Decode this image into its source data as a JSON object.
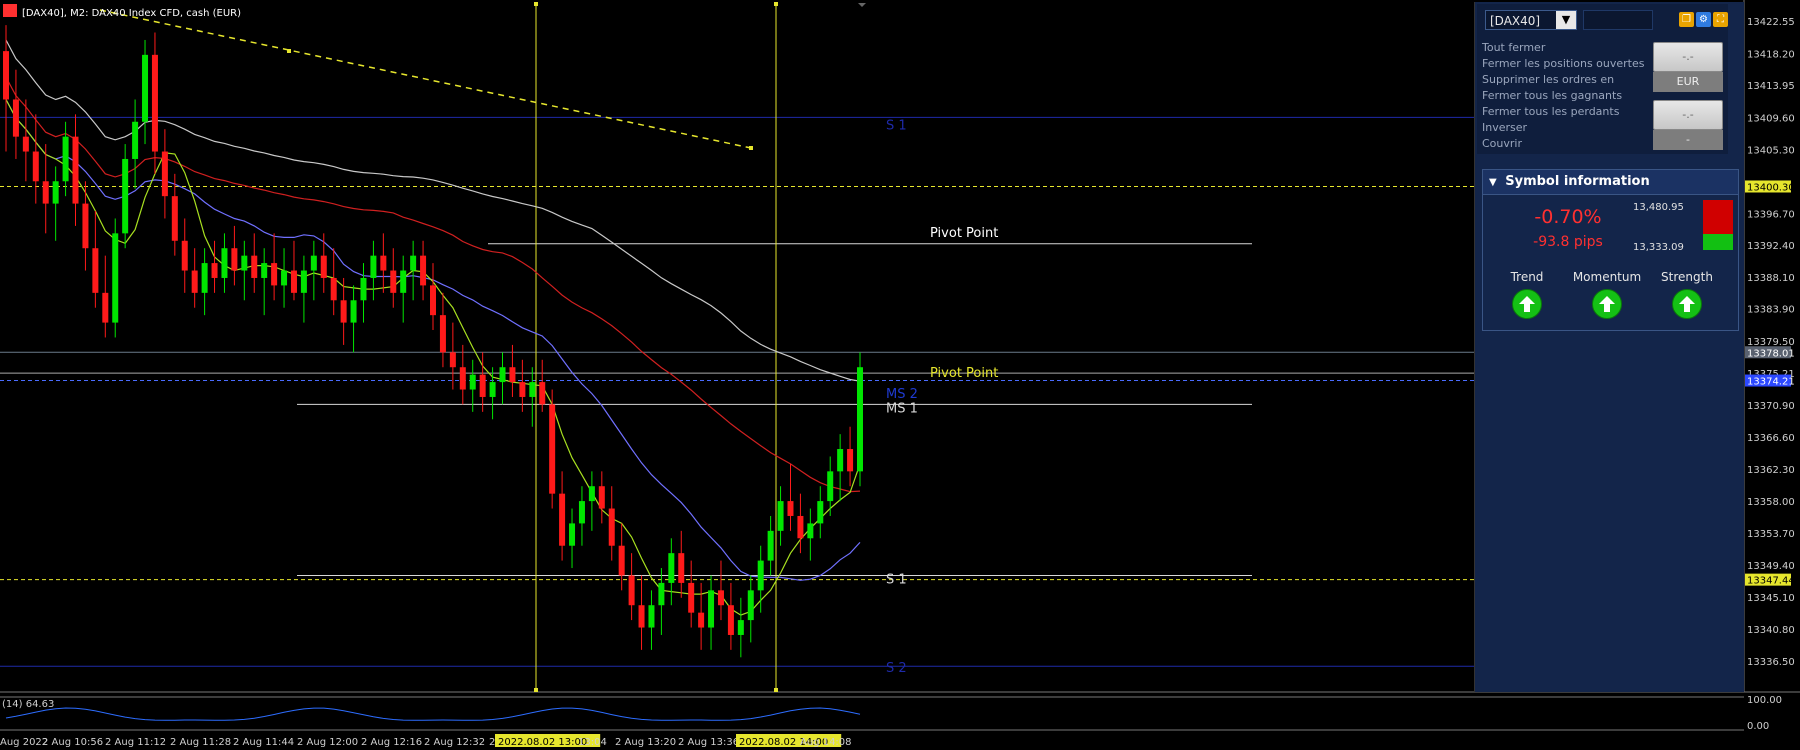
{
  "window_title": "[DAX40], M2:  DAX40 Index CFD, cash (EUR)",
  "colors": {
    "bull": "#00e600",
    "bear": "#ff1a1a",
    "panel": "#13254a",
    "accent_red": "#ff3030",
    "trend_green": "#14c014"
  },
  "price_scale": {
    "ticks": [
      "13422.55",
      "13418.20",
      "13413.95",
      "13409.60",
      "13405.30",
      "13400.30",
      "13396.70",
      "13392.40",
      "13388.10",
      "13383.90",
      "13379.50",
      "13378.01",
      "13375.21",
      "13374.21",
      "13370.90",
      "13366.60",
      "13362.30",
      "13358.00",
      "13353.70",
      "13349.40",
      "13347.44",
      "13345.10",
      "13340.80",
      "13336.50"
    ],
    "markers": [
      {
        "label": "13400.30",
        "style": "yellow"
      },
      {
        "label": "13378.01",
        "style": "gray"
      },
      {
        "label": "13374.21",
        "style": "blue"
      },
      {
        "label": "13347.44",
        "style": "yellow"
      }
    ]
  },
  "levels": [
    {
      "label": "S 1",
      "price": 13409.6
    },
    {
      "label": "Pivot Point",
      "price": 13392.6
    },
    {
      "label": "Pivot Point",
      "price": 13374.8
    },
    {
      "label": "MS 2",
      "price": 13373.6
    },
    {
      "label": "MS 1",
      "price": 13371.0
    },
    {
      "label": "S 1",
      "price": 13348.0
    },
    {
      "label": "S 2",
      "price": 13335.8
    }
  ],
  "time_axis": [
    "Aug 2022",
    "2 Aug 10:56",
    "2 Aug 11:12",
    "2 Aug 11:28",
    "2 Aug 11:44",
    "2 Aug 12:00",
    "2 Aug 12:16",
    "2 Aug 12:32",
    "2 Aug 12:",
    "2022.08.02 13:00",
    "13:04",
    "2 Aug 13:20",
    "2 Aug 13:36",
    "2022.08.02 14:00",
    "Aug 14:08"
  ],
  "oscillator": {
    "label": "(14) 64.63",
    "levels": [
      "100.00",
      "0.00"
    ]
  },
  "trade_panel": {
    "symbol": "[DAX40]",
    "actions": [
      "Tout fermer",
      "Fermer les positions ouvertes",
      "Supprimer les ordres en",
      "Fermer tous les gagnants",
      "Fermer tous les perdants",
      "Inverser",
      "Couvrir"
    ],
    "button1": "-.-",
    "button1_sub": "EUR",
    "button2": "-.-",
    "button2_sub": "-"
  },
  "symbol_info": {
    "title": "Symbol information",
    "change_pct": "-0.70%",
    "change_pips": "-93.8 pips",
    "high": "13,480.95",
    "low": "13,333.09",
    "indicators": [
      {
        "label": "Trend",
        "direction": "up"
      },
      {
        "label": "Momentum",
        "direction": "up"
      },
      {
        "label": "Strength",
        "direction": "up"
      }
    ]
  },
  "chart_data": {
    "type": "candlestick",
    "candles": [
      [
        13418.5,
        13422,
        13405,
        13412
      ],
      [
        13412,
        13416,
        13404,
        13407
      ],
      [
        13407,
        13412,
        13401,
        13405
      ],
      [
        13405,
        13410,
        13398,
        13401
      ],
      [
        13401,
        13406,
        13394,
        13398
      ],
      [
        13398,
        13403,
        13393,
        13401
      ],
      [
        13401,
        13409,
        13399,
        13407
      ],
      [
        13407,
        13410,
        13395,
        13398
      ],
      [
        13398,
        13401,
        13389,
        13392
      ],
      [
        13392,
        13397,
        13384,
        13386
      ],
      [
        13386,
        13391,
        13380,
        13382
      ],
      [
        13382,
        13396,
        13380,
        13394
      ],
      [
        13394,
        13406,
        13392,
        13404
      ],
      [
        13404,
        13412,
        13400,
        13409
      ],
      [
        13409,
        13420,
        13406,
        13418
      ],
      [
        13418,
        13421,
        13402,
        13405
      ],
      [
        13405,
        13408,
        13396,
        13399
      ],
      [
        13399,
        13402,
        13391,
        13393
      ],
      [
        13393,
        13396,
        13386,
        13389
      ],
      [
        13389,
        13392,
        13384,
        13386
      ],
      [
        13386,
        13392,
        13383,
        13390
      ],
      [
        13390,
        13393,
        13386,
        13388
      ],
      [
        13388,
        13394,
        13386,
        13392
      ],
      [
        13392,
        13395,
        13387,
        13389
      ],
      [
        13389,
        13393,
        13385,
        13391
      ],
      [
        13391,
        13394,
        13386,
        13388
      ],
      [
        13388,
        13392,
        13383,
        13390
      ],
      [
        13390,
        13394,
        13385,
        13387
      ],
      [
        13387,
        13392,
        13384,
        13389
      ],
      [
        13389,
        13393,
        13385,
        13386
      ],
      [
        13386,
        13391,
        13382,
        13389
      ],
      [
        13389,
        13393,
        13385,
        13391
      ],
      [
        13391,
        13394,
        13386,
        13388
      ],
      [
        13388,
        13392,
        13383,
        13385
      ],
      [
        13385,
        13388,
        13379,
        13382
      ],
      [
        13382,
        13387,
        13378,
        13385
      ],
      [
        13385,
        13390,
        13382,
        13388
      ],
      [
        13388,
        13393,
        13385,
        13391
      ],
      [
        13391,
        13394,
        13386,
        13389
      ],
      [
        13389,
        13392,
        13384,
        13386
      ],
      [
        13386,
        13391,
        13382,
        13389
      ],
      [
        13389,
        13393,
        13385,
        13391
      ],
      [
        13391,
        13393,
        13385,
        13387
      ],
      [
        13387,
        13390,
        13381,
        13383
      ],
      [
        13383,
        13386,
        13376,
        13378
      ],
      [
        13378,
        13382,
        13373,
        13376
      ],
      [
        13376,
        13379,
        13371,
        13373
      ],
      [
        13373,
        13377,
        13370,
        13375
      ],
      [
        13375,
        13378,
        13370,
        13372
      ],
      [
        13372,
        13376,
        13369,
        13374
      ],
      [
        13374,
        13378,
        13371,
        13376
      ],
      [
        13376,
        13379,
        13372,
        13374
      ],
      [
        13374,
        13377,
        13370,
        13372
      ],
      [
        13372,
        13376,
        13368,
        13374
      ],
      [
        13374,
        13377,
        13370,
        13371
      ],
      [
        13371,
        13373,
        13357,
        13359
      ],
      [
        13359,
        13362,
        13350,
        13352
      ],
      [
        13352,
        13357,
        13349,
        13355
      ],
      [
        13355,
        13360,
        13352,
        13358
      ],
      [
        13358,
        13362,
        13354,
        13360
      ],
      [
        13360,
        13362,
        13355,
        13357
      ],
      [
        13357,
        13360,
        13350,
        13352
      ],
      [
        13352,
        13355,
        13346,
        13348
      ],
      [
        13348,
        13351,
        13342,
        13344
      ],
      [
        13344,
        13348,
        13338,
        13341
      ],
      [
        13341,
        13346,
        13338,
        13344
      ],
      [
        13344,
        13349,
        13340,
        13347
      ],
      [
        13347,
        13353,
        13344,
        13351
      ],
      [
        13351,
        13354,
        13345,
        13347
      ],
      [
        13347,
        13350,
        13341,
        13343
      ],
      [
        13343,
        13347,
        13338,
        13341
      ],
      [
        13341,
        13348,
        13338,
        13346
      ],
      [
        13346,
        13350,
        13342,
        13344
      ],
      [
        13344,
        13347,
        13338,
        13340
      ],
      [
        13340,
        13345,
        13337,
        13342
      ],
      [
        13342,
        13348,
        13339,
        13346
      ],
      [
        13346,
        13352,
        13343,
        13350
      ],
      [
        13350,
        13356,
        13348,
        13354
      ],
      [
        13354,
        13360,
        13352,
        13358
      ],
      [
        13358,
        13363,
        13354,
        13356
      ],
      [
        13356,
        13359,
        13351,
        13353
      ],
      [
        13353,
        13357,
        13350,
        13355
      ],
      [
        13355,
        13360,
        13353,
        13358
      ],
      [
        13358,
        13364,
        13356,
        13362
      ],
      [
        13362,
        13367,
        13358,
        13365
      ],
      [
        13365,
        13368,
        13360,
        13362
      ],
      [
        13362,
        13378,
        13360,
        13376
      ]
    ]
  }
}
